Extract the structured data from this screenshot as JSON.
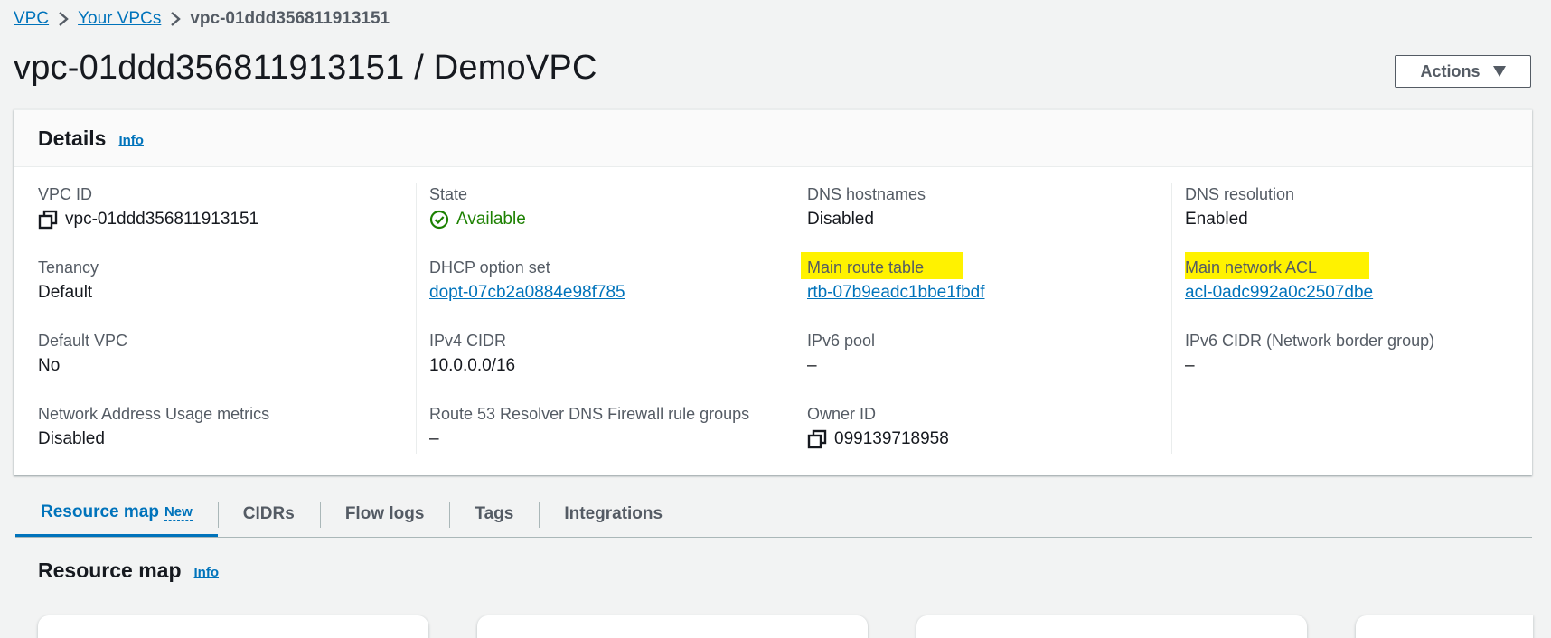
{
  "breadcrumb": {
    "items": [
      "VPC",
      "Your VPCs"
    ],
    "current": "vpc-01ddd356811913151"
  },
  "page": {
    "title": "vpc-01ddd356811913151 / DemoVPC",
    "actions_label": "Actions"
  },
  "details": {
    "title": "Details",
    "info_label": "Info",
    "columns": [
      [
        {
          "label": "VPC ID",
          "value": "vpc-01ddd356811913151"
        },
        {
          "label": "Tenancy",
          "value": "Default"
        },
        {
          "label": "Default VPC",
          "value": "No"
        },
        {
          "label": "Network Address Usage metrics",
          "value": "Disabled"
        }
      ],
      [
        {
          "label": "State",
          "value": "Available"
        },
        {
          "label": "DHCP option set",
          "value": "dopt-07cb2a0884e98f785"
        },
        {
          "label": "IPv4 CIDR",
          "value": "10.0.0.0/16"
        },
        {
          "label": "Route 53 Resolver DNS Firewall rule groups",
          "value": "–"
        }
      ],
      [
        {
          "label": "DNS hostnames",
          "value": "Disabled"
        },
        {
          "label": "Main route table",
          "value": "rtb-07b9eadc1bbe1fbdf"
        },
        {
          "label": "IPv6 pool",
          "value": "–"
        },
        {
          "label": "Owner ID",
          "value": "099139718958"
        }
      ],
      [
        {
          "label": "DNS resolution",
          "value": "Enabled"
        },
        {
          "label": "Main network ACL",
          "value": "acl-0adc992a0c2507dbe"
        },
        {
          "label": "IPv6 CIDR (Network border group)",
          "value": "–"
        }
      ]
    ]
  },
  "tabs": {
    "resource_map": "Resource map",
    "new_badge": "New",
    "cidrs": "CIDRs",
    "flow_logs": "Flow logs",
    "tags": "Tags",
    "integrations": "Integrations"
  },
  "resource_map": {
    "title": "Resource map",
    "info_label": "Info"
  },
  "colors": {
    "link": "#0073bb",
    "success": "#1d8102",
    "highlight": "#fff200"
  }
}
